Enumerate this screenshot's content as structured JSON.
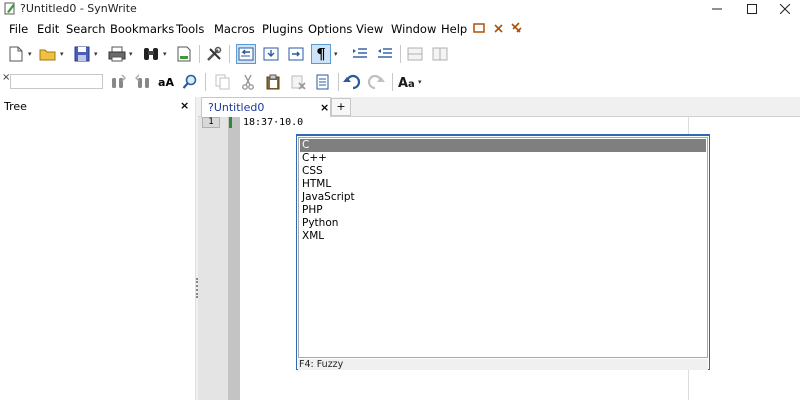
{
  "window": {
    "title": "?Untitled0 - SynWrite",
    "minimize_icon": "minimize-icon",
    "maximize_icon": "maximize-icon",
    "close_icon": "close-icon"
  },
  "menu": {
    "items": [
      "File",
      "Edit",
      "Search",
      "Bookmarks",
      "Tools",
      "Macros",
      "Plugins",
      "Options",
      "View",
      "Window",
      "Help"
    ],
    "extras": [
      "restore-icon",
      "close-icon",
      "pin-icon"
    ]
  },
  "toolbar": {
    "search_placeholder": "",
    "search_value": "",
    "case_label": "aA"
  },
  "tree": {
    "title": "Tree",
    "close_label": "×"
  },
  "tabs": {
    "active_label": "?Untitled0",
    "close_label": "×",
    "add_label": "+"
  },
  "editor": {
    "line_number": "1",
    "code_text": "18:37·10.0"
  },
  "autocomplete": {
    "items": [
      "C",
      "C++",
      "CSS",
      "HTML",
      "JavaScript",
      "PHP",
      "Python",
      "XML"
    ],
    "selected_index": 0,
    "status": "F4: Fuzzy"
  },
  "colors": {
    "selected_bg": "#7f7f7f",
    "accent": "#2d6ab4",
    "tab_text": "#1a3a9a",
    "modified_mark": "#2e8b2e"
  }
}
